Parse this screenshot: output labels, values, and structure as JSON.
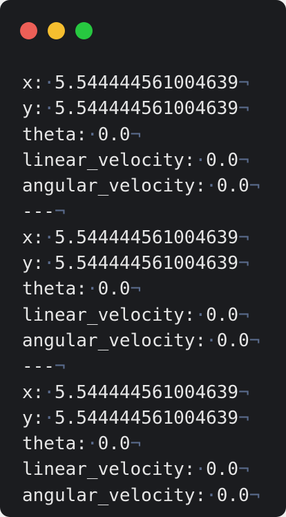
{
  "window": {
    "buttons": [
      {
        "name": "close",
        "color": "#ed5f57"
      },
      {
        "name": "minimize",
        "color": "#f6be2f"
      },
      {
        "name": "maximize",
        "color": "#27c840"
      }
    ]
  },
  "whitespace_glyphs": {
    "space": "·",
    "eol": "¬"
  },
  "lines": [
    {
      "key": "x:",
      "value": "5.544444561004639"
    },
    {
      "key": "y:",
      "value": "5.544444561004639"
    },
    {
      "key": "theta:",
      "value": "0.0"
    },
    {
      "key": "linear_velocity:",
      "value": "0.0"
    },
    {
      "key": "angular_velocity:",
      "value": "0.0"
    },
    {
      "key": "---",
      "value": ""
    },
    {
      "key": "x:",
      "value": "5.544444561004639"
    },
    {
      "key": "y:",
      "value": "5.544444561004639"
    },
    {
      "key": "theta:",
      "value": "0.0"
    },
    {
      "key": "linear_velocity:",
      "value": "0.0"
    },
    {
      "key": "angular_velocity:",
      "value": "0.0"
    },
    {
      "key": "---",
      "value": ""
    },
    {
      "key": "x:",
      "value": "5.544444561004639"
    },
    {
      "key": "y:",
      "value": "5.544444561004639"
    },
    {
      "key": "theta:",
      "value": "0.0"
    },
    {
      "key": "linear_velocity:",
      "value": "0.0"
    },
    {
      "key": "angular_velocity:",
      "value": "0.0"
    }
  ]
}
